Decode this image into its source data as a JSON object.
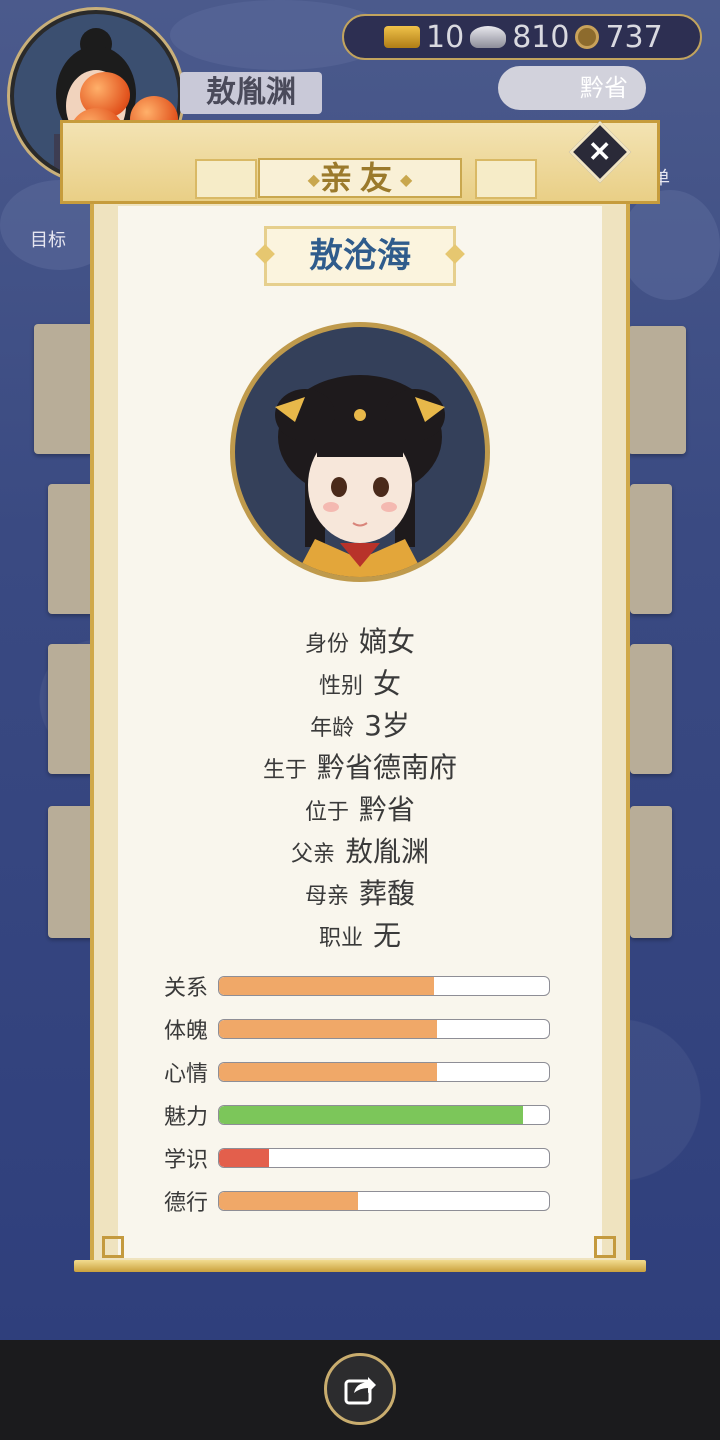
{
  "header": {
    "player_name": "敖胤渊",
    "resources": {
      "gold": "10",
      "silver": "810",
      "coins": "737"
    },
    "province": "黔省",
    "goal_label": "目标",
    "menu_label": "菜单"
  },
  "modal": {
    "title": "亲友",
    "person_name": "敖沧海",
    "info": [
      {
        "key": "身份",
        "value": "嫡女"
      },
      {
        "key": "性别",
        "value": "女"
      },
      {
        "key": "年龄",
        "value": "3岁"
      },
      {
        "key": "生于",
        "value": "黔省德南府"
      },
      {
        "key": "位于",
        "value": "黔省"
      },
      {
        "key": "父亲",
        "value": "敖胤渊"
      },
      {
        "key": "母亲",
        "value": "葬馥"
      },
      {
        "key": "职业",
        "value": "无"
      }
    ],
    "stats": [
      {
        "label": "关系",
        "level": 0.65,
        "color": "#f0a868"
      },
      {
        "label": "体魄",
        "level": 0.66,
        "color": "#f0a868"
      },
      {
        "label": "心情",
        "level": 0.66,
        "color": "#f0a868"
      },
      {
        "label": "魅力",
        "level": 0.92,
        "color": "#7cc65a"
      },
      {
        "label": "学识",
        "level": 0.15,
        "color": "#e35f4c"
      },
      {
        "label": "德行",
        "level": 0.42,
        "color": "#f0a868"
      }
    ]
  }
}
